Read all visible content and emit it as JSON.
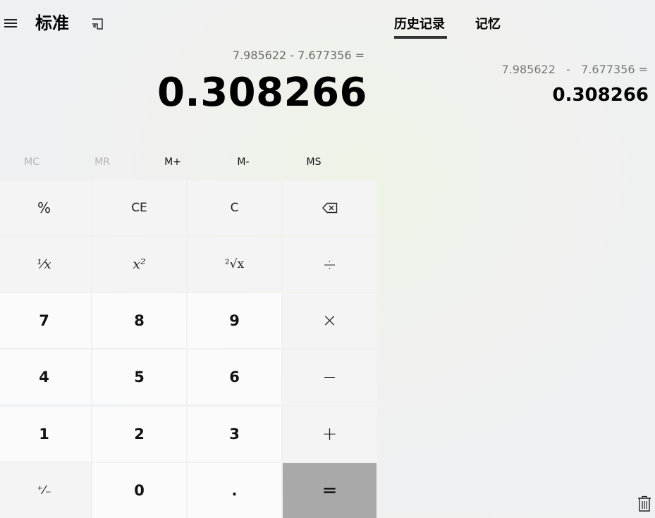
{
  "header": {
    "menu_icon": "hamburger-icon",
    "mode_title": "标准",
    "keep_on_top_icon": "keep-on-top-icon"
  },
  "display": {
    "expression": "7.985622 - 7.677356 =",
    "value": "0.308266"
  },
  "memory": {
    "mc": "MC",
    "mr": "MR",
    "m_plus": "M+",
    "m_minus": "M-",
    "ms": "MS"
  },
  "keys": {
    "percent": "%",
    "ce": "CE",
    "c": "C",
    "backspace_icon": "backspace-icon",
    "reciprocal": "¹⁄x",
    "square": "x²",
    "sqrt": "²√x",
    "divide": "÷",
    "multiply": "×",
    "minus": "−",
    "plus": "+",
    "equals": "=",
    "negate": "⁺⁄₋",
    "decimal": ".",
    "d0": "0",
    "d1": "1",
    "d2": "2",
    "d3": "3",
    "d4": "4",
    "d5": "5",
    "d6": "6",
    "d7": "7",
    "d8": "8",
    "d9": "9"
  },
  "panel": {
    "tab_history": "历史记录",
    "tab_memory": "记忆",
    "history_expression": "7.985622   -   7.677356 =",
    "history_result": "0.308266",
    "trash_icon": "trash-icon"
  },
  "colors": {
    "equals_key": "#a9a9a9",
    "number_key": "#fbfbfb",
    "function_key": "#f4f4f4"
  }
}
